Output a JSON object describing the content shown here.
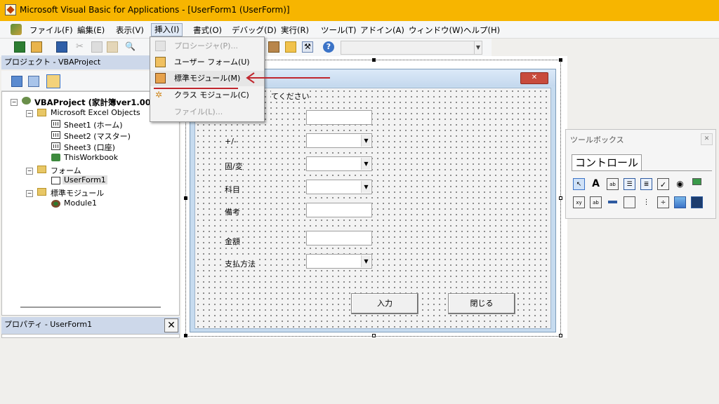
{
  "window": {
    "title": "Microsoft Visual Basic for Applications - [UserForm1 (UserForm)]"
  },
  "menubar": {
    "items": [
      "ファイル(F)",
      "編集(E)",
      "表示(V)",
      "挿入(I)",
      "書式(O)",
      "デバッグ(D)",
      "実行(R)",
      "ツール(T)",
      "アドイン(A)",
      "ウィンドウ(W)",
      "ヘルプ(H)"
    ]
  },
  "insert_menu": {
    "items": [
      {
        "label": "プロシージャ(P)...",
        "enabled": false,
        "icon": "procedure-icon"
      },
      {
        "label": "ユーザー フォーム(U)",
        "enabled": true,
        "icon": "userform-icon"
      },
      {
        "label": "標準モジュール(M)",
        "enabled": true,
        "highlighted": true,
        "icon": "module-icon"
      },
      {
        "label": "クラス モジュール(C)",
        "enabled": true,
        "icon": "class-module-icon"
      },
      {
        "label": "ファイル(L)...",
        "enabled": false,
        "icon": ""
      }
    ]
  },
  "annotation": {
    "arrow_color": "#c0262d",
    "underline_color": "#c0262d"
  },
  "project_pane": {
    "title": "プロジェクト - VBAProject",
    "tree": {
      "root": "VBAProject (家計簿ver1.00",
      "excel_objects": "Microsoft Excel Objects",
      "sheets": [
        "Sheet1 (ホーム)",
        "Sheet2 (マスター)",
        "Sheet3 (口座)",
        "ThisWorkbook"
      ],
      "forms_folder": "フォーム",
      "forms": [
        "UserForm1"
      ],
      "modules_folder": "標準モジュール",
      "modules": [
        "Module1"
      ]
    }
  },
  "properties_pane": {
    "title": "プロパティ - UserForm1",
    "close": "✕"
  },
  "userform": {
    "instruction": "てください",
    "labels": [
      "+/-",
      "固/変",
      "科目",
      "備考",
      "金額",
      "支払方法"
    ],
    "buttons": {
      "submit": "入力",
      "close": "閉じる"
    },
    "caption_close": "✕"
  },
  "toolbox": {
    "title": "ツールボックス",
    "close": "✕",
    "tab": "コントロール",
    "tools_row1": [
      "select-pointer-icon",
      "label-icon",
      "textbox-icon",
      "combobox-icon",
      "listbox-icon",
      "checkbox-icon",
      "optionbutton-icon",
      "togglebutton-icon"
    ],
    "tools_row2": [
      "frame-icon",
      "commandbutton-icon",
      "tabstrip-icon",
      "multipage-icon",
      "scrollbar-icon",
      "spinbutton-icon",
      "image-icon",
      "refedit-icon"
    ]
  }
}
